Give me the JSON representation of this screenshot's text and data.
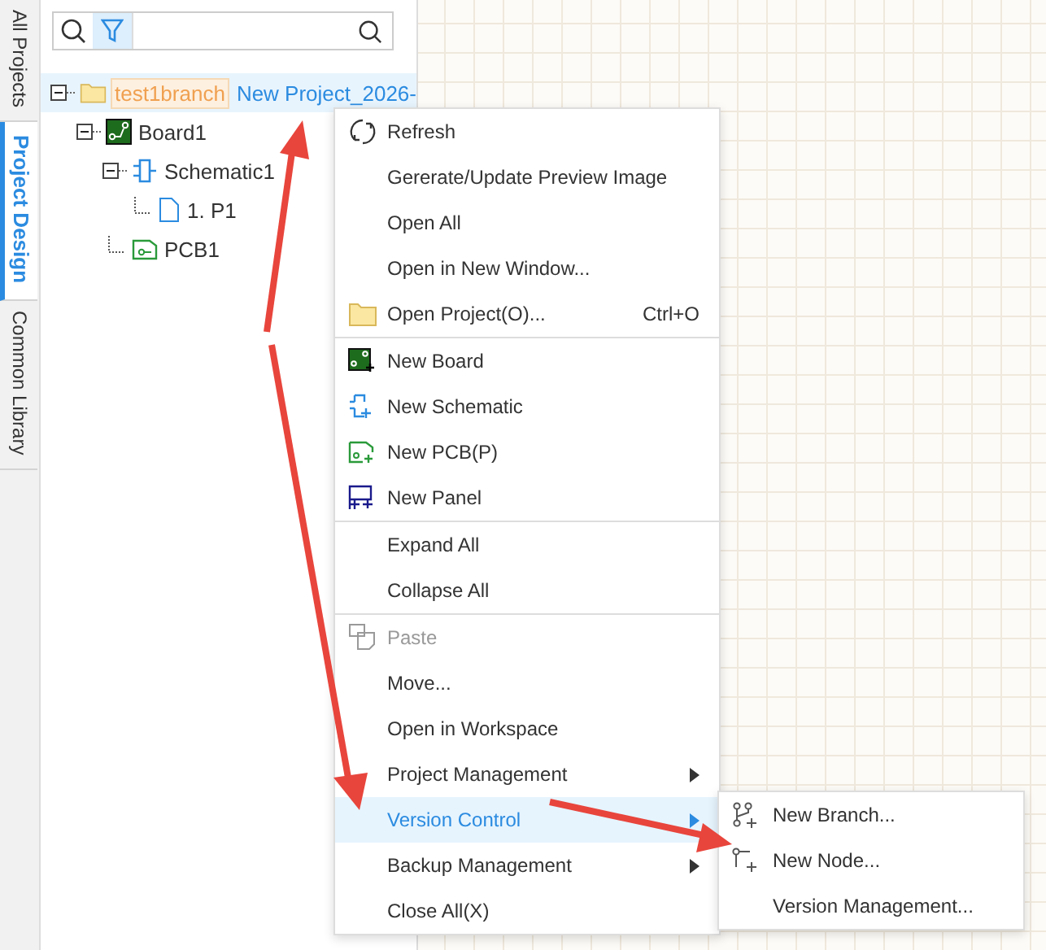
{
  "side_tabs": [
    {
      "label": "All Projects",
      "selected": false
    },
    {
      "label": "Project Design",
      "selected": true
    },
    {
      "label": "Common Library",
      "selected": false
    }
  ],
  "filter": {
    "selected": true
  },
  "tree": [
    {
      "kind": "folder",
      "tag": "test1branch",
      "label": "New Project_2026-",
      "expanded": true,
      "selected": true,
      "children": [
        {
          "kind": "board",
          "label": "Board1",
          "expanded": true,
          "selected": false,
          "children": [
            {
              "kind": "schematic",
              "label": "Schematic1",
              "expanded": true,
              "selected": false,
              "children": [
                {
                  "kind": "page",
                  "label": "1. P1",
                  "selected": false
                }
              ]
            },
            {
              "kind": "pcb",
              "label": "PCB1",
              "selected": false
            }
          ]
        }
      ]
    }
  ],
  "context_menu": {
    "sections": [
      [
        {
          "kind": "refresh",
          "label": "Refresh",
          "selected": false,
          "disabled": false
        },
        {
          "kind": "plain",
          "label": "Gererate/Update Preview Image",
          "selected": false,
          "disabled": false
        },
        {
          "kind": "plain",
          "label": "Open All",
          "selected": false,
          "disabled": false
        },
        {
          "kind": "plain",
          "label": "Open in New Window...",
          "selected": false,
          "disabled": false
        },
        {
          "kind": "folder",
          "label": "Open Project(O)...",
          "shortcut": "Ctrl+O",
          "selected": false,
          "disabled": false
        }
      ],
      [
        {
          "kind": "board",
          "label": "New Board",
          "selected": false,
          "disabled": false
        },
        {
          "kind": "schematic",
          "label": "New Schematic",
          "selected": false,
          "disabled": false
        },
        {
          "kind": "pcb",
          "label": "New PCB(P)",
          "selected": false,
          "disabled": false
        },
        {
          "kind": "panel",
          "label": "New Panel",
          "selected": false,
          "disabled": false
        }
      ],
      [
        {
          "kind": "plain",
          "label": "Expand All",
          "selected": false,
          "disabled": false
        },
        {
          "kind": "plain",
          "label": "Collapse All",
          "selected": false,
          "disabled": false
        }
      ],
      [
        {
          "kind": "paste",
          "label": "Paste",
          "selected": false,
          "disabled": true
        },
        {
          "kind": "plain",
          "label": "Move...",
          "selected": false,
          "disabled": false
        },
        {
          "kind": "plain",
          "label": "Open in Workspace",
          "selected": false,
          "disabled": false
        },
        {
          "kind": "plain",
          "label": "Project Management",
          "submenu": true,
          "selected": false,
          "disabled": false
        },
        {
          "kind": "plain",
          "label": "Version Control",
          "submenu": true,
          "selected": true,
          "disabled": false
        },
        {
          "kind": "plain",
          "label": "Backup Management",
          "submenu": true,
          "selected": false,
          "disabled": false
        },
        {
          "kind": "plain",
          "label": "Close All(X)",
          "selected": false,
          "disabled": false
        }
      ]
    ]
  },
  "submenu": {
    "items": [
      {
        "kind": "branch",
        "label": "New Branch..."
      },
      {
        "kind": "node",
        "label": "New Node..."
      },
      {
        "kind": "plain",
        "label": "Version Management..."
      }
    ]
  }
}
